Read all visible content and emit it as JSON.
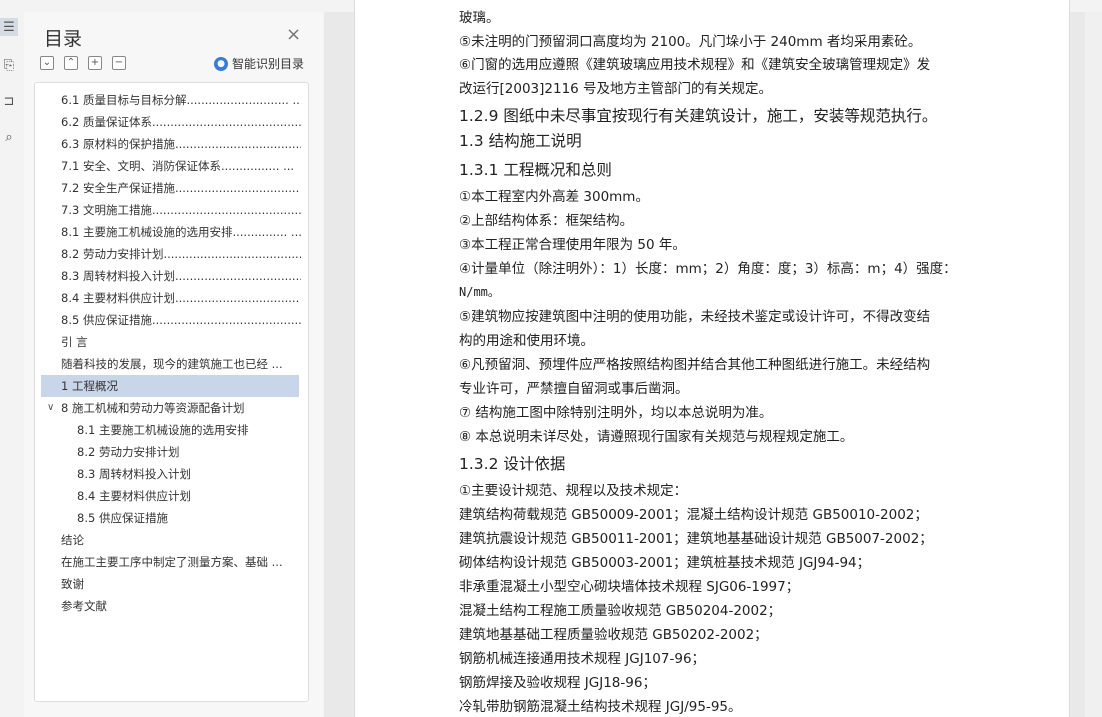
{
  "sidebar": {
    "title": "目录",
    "close": "×",
    "tools": [
      "⌄",
      "⌃",
      "+",
      "−"
    ],
    "smart_label": "智能识别目录",
    "toc": [
      {
        "label": "6.1  质量目标与目标分解............................ ..."
      },
      {
        "label": "6.2  质量保证体系......................................... ..."
      },
      {
        "label": "6.3  原材料的保护措施................................... ..."
      },
      {
        "label": "7.1  安全、文明、消防保证体系................ ..."
      },
      {
        "label": "7.2  安全生产保证措施.................................. ..."
      },
      {
        "label": "7.3  文明施工措施.......................................... ..."
      },
      {
        "label": "8.1  主要施工机械设施的选用安排............... ..."
      },
      {
        "label": "8.2  劳动力安排计划....................................... ..."
      },
      {
        "label": "8.3  周转材料投入计划................................... ..."
      },
      {
        "label": "8.4  主要材料供应计划.................................. ..."
      },
      {
        "label": "8.5  供应保证措施.......................................... ..."
      },
      {
        "label": "引      言"
      },
      {
        "label": "随着科技的发展，现今的建筑施工也已经 ..."
      },
      {
        "label": "1   工程概况"
      },
      {
        "label": "8 施工机械和劳动力等资源配备计划"
      },
      {
        "label": "8.1 主要施工机械设施的选用安排"
      },
      {
        "label": "8.2 劳动力安排计划"
      },
      {
        "label": "8.3 周转材料投入计划"
      },
      {
        "label": "8.4    主要材料供应计划"
      },
      {
        "label": "8.5 供应保证措施"
      },
      {
        "label": "结论"
      },
      {
        "label": "在施工主要工序中制定了测量方案、基础 ..."
      },
      {
        "label": "致谢"
      },
      {
        "label": "参考文献"
      }
    ]
  },
  "document": {
    "lines": [
      "玻璃。",
      "⑤未注明的门预留洞口高度均为 2100。凡门垛小于 240mm 者均采用素砼。",
      "⑥门窗的选用应遵照《建筑玻璃应用技术规程》和《建筑安全玻璃管理规定》发",
      "改运行[2003]2116 号及地方主管部门的有关规定。",
      "1.2.9 图纸中未尽事宜按现行有关建筑设计，施工，安装等规范执行。",
      "1.3  结构施工说明",
      "1.3.1 工程概况和总则",
      "①本工程室内外高差 300mm。",
      "②上部结构体系：框架结构。",
      "③本工程正常合理使用年限为 50 年。",
      "④计量单位（除注明外）：1）长度：mm；2）角度：度；3）标高：m；4）强度：",
      "N/mm。",
      "⑤建筑物应按建筑图中注明的使用功能，未经技术鉴定或设计许可，不得改变结",
      "构的用途和使用环境。",
      "⑥凡预留洞、预埋件应严格按照结构图并结合其他工种图纸进行施工。未经结构",
      "专业许可，严禁擅自留洞或事后凿洞。",
      "⑦  结构施工图中除特别注明外，均以本总说明为准。",
      "⑧  本总说明未详尽处，请遵照现行国家有关规范与规程规定施工。",
      "1.3.2 设计依据",
      "①主要设计规范、规程以及技术规定：",
      "建筑结构荷载规范 GB50009-2001；混凝土结构设计规范 GB50010-2002；",
      "建筑抗震设计规范 GB50011-2001；建筑地基基础设计规范 GB5007-2002；",
      "砌体结构设计规范 GB50003-2001；建筑桩基技术规范 JGJ94-94；",
      "非承重混凝土小型空心砌块墙体技术规程 SJG06-1997；",
      "混凝土结构工程施工质量验收规范 GB50204-2002；",
      "建筑地基基础工程质量验收规范 GB50202-2002；",
      "钢筋机械连接通用技术规程 JGJ107-96；",
      "钢筋焊接及验收规程 JGJ18-96；",
      "冷轧带肋钢筋混凝土结构技术规程 JGJ/95-95。"
    ]
  }
}
